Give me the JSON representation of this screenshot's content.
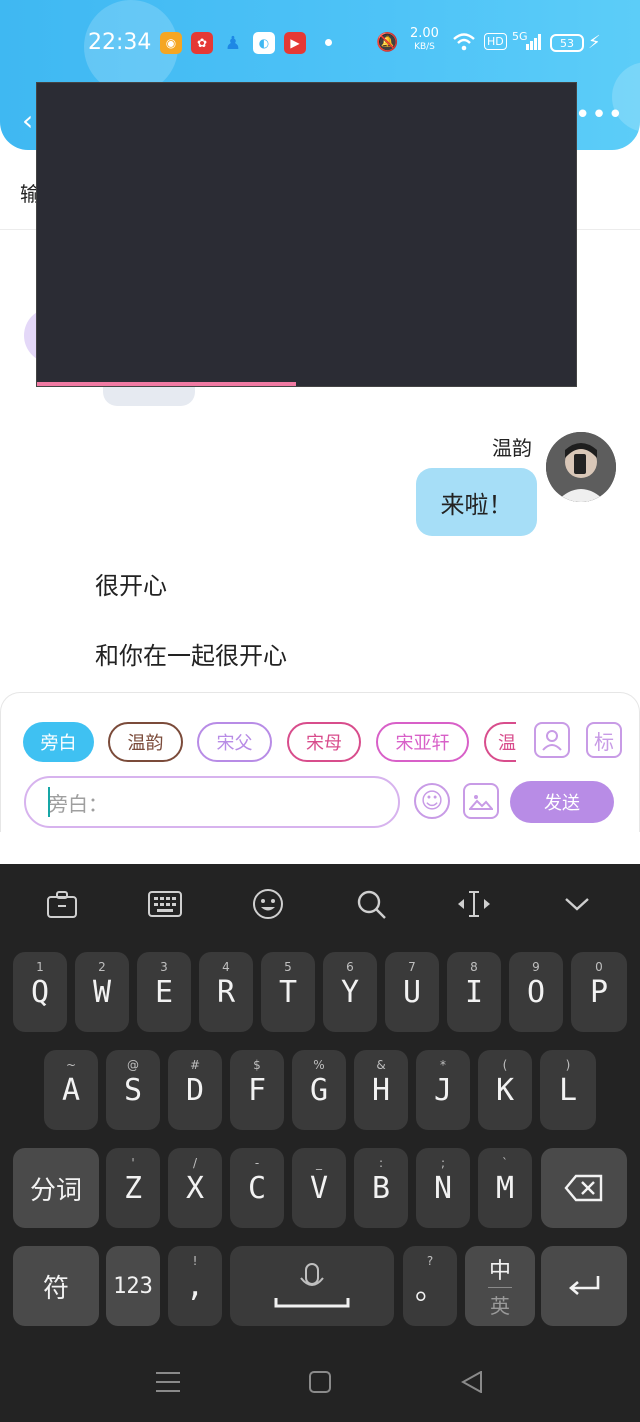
{
  "status": {
    "time": "22:34",
    "net_speed": "2.00",
    "net_unit": "KB/S",
    "hd": "HD",
    "signal": "5G",
    "battery": "53"
  },
  "header": {
    "subtitle": "输"
  },
  "video": {
    "progress_pct": 48
  },
  "chat": {
    "sender_name": "温韵",
    "message": "来啦！",
    "narration_1": "很开心",
    "narration_2": "和你在一起很开心"
  },
  "composer": {
    "chips": [
      "旁白",
      "温韵",
      "宋父",
      "宋母",
      "宋亚轩",
      "温"
    ],
    "chip_colors": [
      "#3fc1f2",
      "#7b4b3a",
      "#b88ce6",
      "#d84d8c",
      "#d860c8",
      "#d84d8c"
    ],
    "tag_label": "标",
    "placeholder": "旁白：",
    "send_label": "发送"
  },
  "keyboard": {
    "row1": [
      [
        "Q",
        "1"
      ],
      [
        "W",
        "2"
      ],
      [
        "E",
        "3"
      ],
      [
        "R",
        "4"
      ],
      [
        "T",
        "5"
      ],
      [
        "Y",
        "6"
      ],
      [
        "U",
        "7"
      ],
      [
        "I",
        "8"
      ],
      [
        "O",
        "9"
      ],
      [
        "P",
        "0"
      ]
    ],
    "row2": [
      [
        "A",
        "~"
      ],
      [
        "S",
        "@"
      ],
      [
        "D",
        "#"
      ],
      [
        "F",
        "$"
      ],
      [
        "G",
        "%"
      ],
      [
        "H",
        "&"
      ],
      [
        "J",
        "*"
      ],
      [
        "K",
        "("
      ],
      [
        "L",
        ")"
      ]
    ],
    "row3": [
      [
        "Z",
        "'"
      ],
      [
        "X",
        "/"
      ],
      [
        "C",
        "-"
      ],
      [
        "V",
        "_"
      ],
      [
        "B",
        ":"
      ],
      [
        "N",
        ";"
      ],
      [
        "M",
        "`"
      ]
    ],
    "segment_label": "分词",
    "symbol_label": "符",
    "num_label": "123",
    "comma": ",",
    "comma_sub": "!",
    "period": "。",
    "period_sub": "?",
    "lang_top": "中",
    "lang_bottom": "英"
  }
}
